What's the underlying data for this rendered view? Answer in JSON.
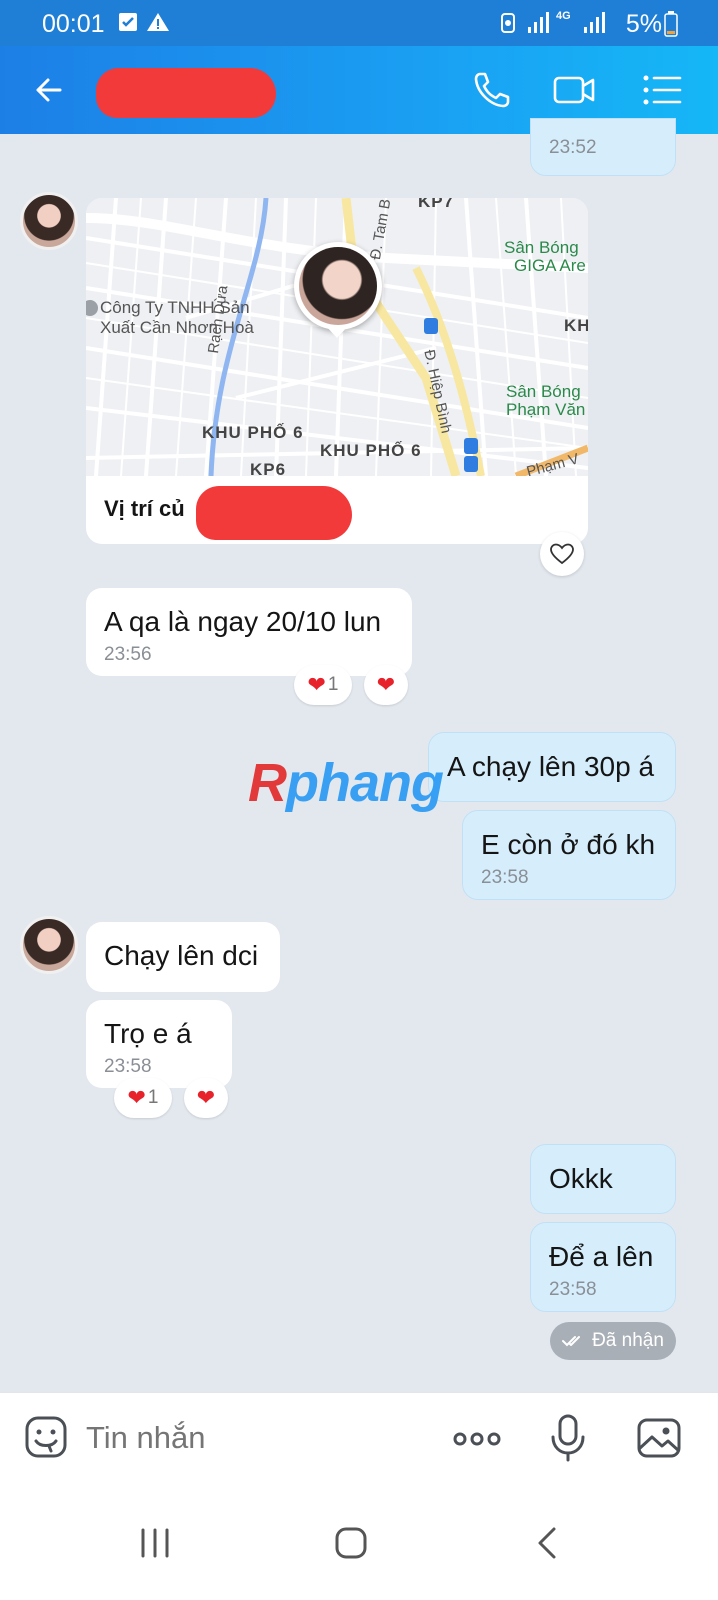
{
  "status_bar": {
    "time": "00:01",
    "battery": "5%",
    "network": "4G"
  },
  "header": {
    "back_icon": "arrow-left-icon",
    "call_icon": "phone-icon",
    "video_icon": "video-camera-icon",
    "menu_icon": "list-menu-icon"
  },
  "top_clipped_message": {
    "time": "23:52"
  },
  "location": {
    "caption": "Vị trí củ",
    "map_labels": {
      "company": "Công Ty TNHH Sản",
      "company2": "Xuất Cần Nhơn Hoà",
      "canal": "Rạch Dừa",
      "khu1": "KHU PHỐ 6",
      "khu2": "KHU PHỐ 6",
      "kp6": "KP6",
      "kp7": "KP7",
      "san_giga": "Sân Bóng",
      "san_giga2": "GIGA Are",
      "san_pham": "Sân Bóng",
      "san_pham2": "Phạm Văn",
      "street_hb": "Đ. Hiệp Bình",
      "street_tb": "Đ. Tam B",
      "street_pv": "Phạm V",
      "kh": "KH"
    }
  },
  "messages": [
    {
      "text": "A qa là ngay 20/10 lun",
      "time": "23:56",
      "reaction_count": "1"
    },
    {
      "text": "A chạy lên 30p á"
    },
    {
      "text": "E còn ở đó kh",
      "time": "23:58"
    },
    {
      "text": "Chạy lên dci"
    },
    {
      "text": "Trọ e á",
      "time": "23:58",
      "reaction_count": "1"
    },
    {
      "text": "Okkk"
    },
    {
      "text": "Để a lên",
      "time": "23:58"
    }
  ],
  "delivery_status": "Đã nhận",
  "watermark": {
    "first": "R",
    "rest": "phang"
  },
  "composer": {
    "placeholder": "Tin nhắn"
  },
  "colors": {
    "header_start": "#1c7fe6",
    "header_end": "#15b7f6",
    "outgoing_bubble": "#d6eefc",
    "reaction_heart": "#e8222a"
  }
}
